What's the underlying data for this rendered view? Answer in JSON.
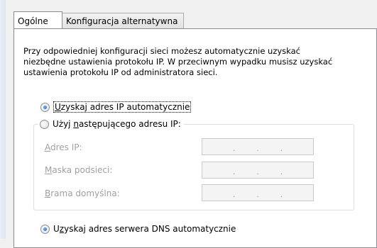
{
  "tabs": [
    {
      "label": "Ogólne",
      "active": true
    },
    {
      "label": "Konfiguracja alternatywna",
      "active": false
    }
  ],
  "description": "Przy odpowiedniej konfiguracji sieci możesz automatycznie uzyskać niezbędne ustawienia protokołu IP. W przeciwnym wypadku musisz uzyskać ustawienia protokołu IP od administratora sieci.",
  "ip_auto": {
    "accel": "U",
    "rest": "zyskaj adres IP automatycznie",
    "checked": true
  },
  "ip_manual": {
    "pre": "Użyj ",
    "accel": "n",
    "rest": "astępującego adresu IP:",
    "checked": false
  },
  "fields": [
    {
      "accel": "A",
      "rest": "dres IP:"
    },
    {
      "accel": "M",
      "rest": "aska podsieci:"
    },
    {
      "accel": "B",
      "rest": "rama domyślna:"
    }
  ],
  "ip_separator": ".",
  "dns_auto": {
    "pre": "U",
    "accel": "z",
    "rest": "yskaj adres serwera DNS automatycznie",
    "checked": true
  }
}
